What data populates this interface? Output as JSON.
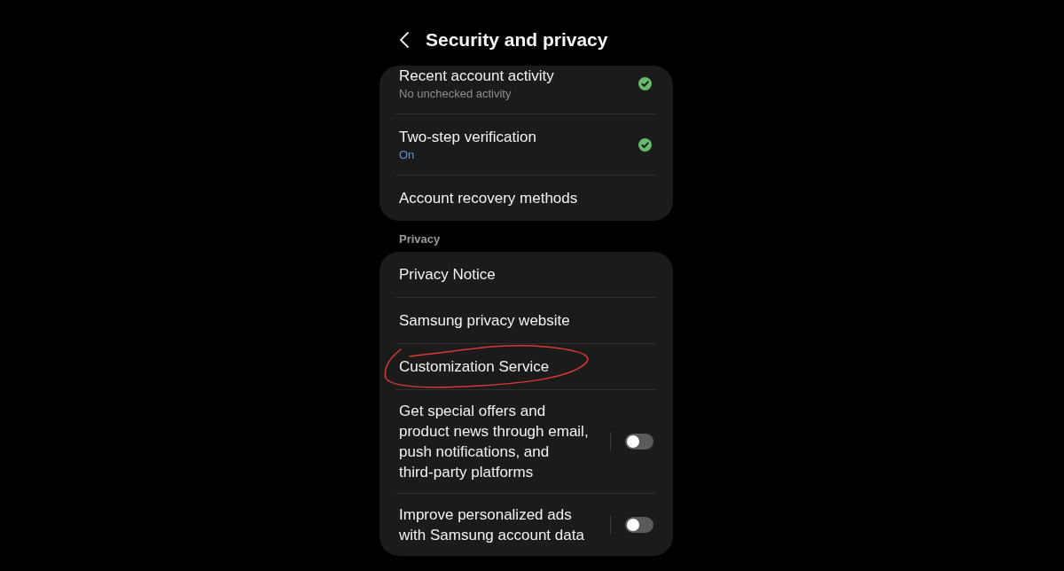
{
  "header": {
    "title": "Security and privacy"
  },
  "groups": [
    {
      "items": [
        {
          "kind": "status",
          "title": "Recent account activity",
          "subtitle": "No unchecked activity",
          "subtitle_accent": false,
          "checked": true
        },
        {
          "kind": "status",
          "title": "Two-step verification",
          "subtitle": "On",
          "subtitle_accent": true,
          "checked": true
        },
        {
          "kind": "link",
          "title": "Account recovery methods"
        }
      ]
    },
    {
      "label": "Privacy",
      "items": [
        {
          "kind": "link",
          "title": "Privacy Notice",
          "circled": false
        },
        {
          "kind": "link",
          "title": "Samsung privacy website",
          "circled": false
        },
        {
          "kind": "link",
          "title": "Customization Service",
          "circled": true
        },
        {
          "kind": "toggle",
          "title": "Get special offers and product news through email, push notifications, and third-party platforms",
          "on": false,
          "circled": false
        },
        {
          "kind": "toggle",
          "title": "Improve personalized ads with Samsung account data",
          "on": false,
          "circled": false
        }
      ]
    }
  ]
}
